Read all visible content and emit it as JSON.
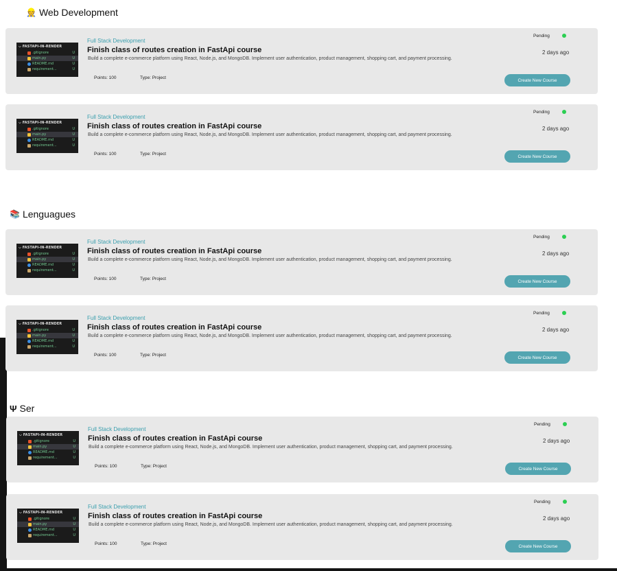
{
  "sections": [
    {
      "emoji": "👷",
      "title": "Web Development"
    },
    {
      "emoji": "📚",
      "title": "Lenguagues"
    },
    {
      "emoji": "Ψ",
      "title": "Ser"
    }
  ],
  "card": {
    "category": "Full Stack Development",
    "title": "Finish class of  routes creation in FastApi course",
    "description": "Build a complete e-commerce platform using React, Node.js, and MongoDB. Implement user authentication, product management, shopping cart, and payment processing.",
    "points": "Points: 100",
    "type": "Type: Project",
    "status": "Pending",
    "time": "2 days ago",
    "button": "Create New Course"
  },
  "thumbnail": {
    "header": "⌵ FASTAPI-IN-RENDER",
    "files": [
      {
        "name": ".gitignore",
        "status": "U",
        "icon_color": "#e8522c"
      },
      {
        "name": "main.py",
        "status": "U",
        "icon_color": "#f3c43b"
      },
      {
        "name": "README.md",
        "status": "U",
        "icon_color": "#3a8ee6"
      },
      {
        "name": "requirement...",
        "status": "U",
        "icon_color": "#c9a66b"
      }
    ]
  },
  "colors": {
    "accent": "#53a5b1",
    "category": "#3b9fae",
    "status_dot": "#2bcf52",
    "card_bg": "#e8e8e8"
  }
}
